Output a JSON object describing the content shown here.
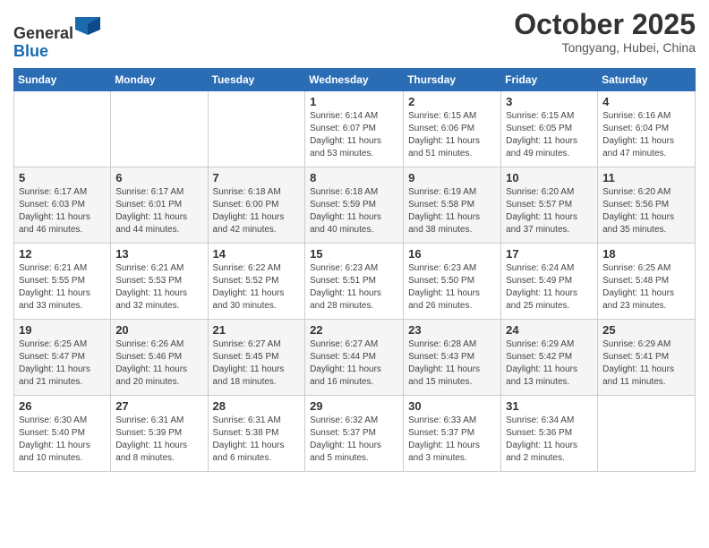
{
  "header": {
    "logo_general": "General",
    "logo_blue": "Blue",
    "month_title": "October 2025",
    "location": "Tongyang, Hubei, China"
  },
  "weekdays": [
    "Sunday",
    "Monday",
    "Tuesday",
    "Wednesday",
    "Thursday",
    "Friday",
    "Saturday"
  ],
  "weeks": [
    [
      {
        "day": "",
        "info": ""
      },
      {
        "day": "",
        "info": ""
      },
      {
        "day": "",
        "info": ""
      },
      {
        "day": "1",
        "info": "Sunrise: 6:14 AM\nSunset: 6:07 PM\nDaylight: 11 hours\nand 53 minutes."
      },
      {
        "day": "2",
        "info": "Sunrise: 6:15 AM\nSunset: 6:06 PM\nDaylight: 11 hours\nand 51 minutes."
      },
      {
        "day": "3",
        "info": "Sunrise: 6:15 AM\nSunset: 6:05 PM\nDaylight: 11 hours\nand 49 minutes."
      },
      {
        "day": "4",
        "info": "Sunrise: 6:16 AM\nSunset: 6:04 PM\nDaylight: 11 hours\nand 47 minutes."
      }
    ],
    [
      {
        "day": "5",
        "info": "Sunrise: 6:17 AM\nSunset: 6:03 PM\nDaylight: 11 hours\nand 46 minutes."
      },
      {
        "day": "6",
        "info": "Sunrise: 6:17 AM\nSunset: 6:01 PM\nDaylight: 11 hours\nand 44 minutes."
      },
      {
        "day": "7",
        "info": "Sunrise: 6:18 AM\nSunset: 6:00 PM\nDaylight: 11 hours\nand 42 minutes."
      },
      {
        "day": "8",
        "info": "Sunrise: 6:18 AM\nSunset: 5:59 PM\nDaylight: 11 hours\nand 40 minutes."
      },
      {
        "day": "9",
        "info": "Sunrise: 6:19 AM\nSunset: 5:58 PM\nDaylight: 11 hours\nand 38 minutes."
      },
      {
        "day": "10",
        "info": "Sunrise: 6:20 AM\nSunset: 5:57 PM\nDaylight: 11 hours\nand 37 minutes."
      },
      {
        "day": "11",
        "info": "Sunrise: 6:20 AM\nSunset: 5:56 PM\nDaylight: 11 hours\nand 35 minutes."
      }
    ],
    [
      {
        "day": "12",
        "info": "Sunrise: 6:21 AM\nSunset: 5:55 PM\nDaylight: 11 hours\nand 33 minutes."
      },
      {
        "day": "13",
        "info": "Sunrise: 6:21 AM\nSunset: 5:53 PM\nDaylight: 11 hours\nand 32 minutes."
      },
      {
        "day": "14",
        "info": "Sunrise: 6:22 AM\nSunset: 5:52 PM\nDaylight: 11 hours\nand 30 minutes."
      },
      {
        "day": "15",
        "info": "Sunrise: 6:23 AM\nSunset: 5:51 PM\nDaylight: 11 hours\nand 28 minutes."
      },
      {
        "day": "16",
        "info": "Sunrise: 6:23 AM\nSunset: 5:50 PM\nDaylight: 11 hours\nand 26 minutes."
      },
      {
        "day": "17",
        "info": "Sunrise: 6:24 AM\nSunset: 5:49 PM\nDaylight: 11 hours\nand 25 minutes."
      },
      {
        "day": "18",
        "info": "Sunrise: 6:25 AM\nSunset: 5:48 PM\nDaylight: 11 hours\nand 23 minutes."
      }
    ],
    [
      {
        "day": "19",
        "info": "Sunrise: 6:25 AM\nSunset: 5:47 PM\nDaylight: 11 hours\nand 21 minutes."
      },
      {
        "day": "20",
        "info": "Sunrise: 6:26 AM\nSunset: 5:46 PM\nDaylight: 11 hours\nand 20 minutes."
      },
      {
        "day": "21",
        "info": "Sunrise: 6:27 AM\nSunset: 5:45 PM\nDaylight: 11 hours\nand 18 minutes."
      },
      {
        "day": "22",
        "info": "Sunrise: 6:27 AM\nSunset: 5:44 PM\nDaylight: 11 hours\nand 16 minutes."
      },
      {
        "day": "23",
        "info": "Sunrise: 6:28 AM\nSunset: 5:43 PM\nDaylight: 11 hours\nand 15 minutes."
      },
      {
        "day": "24",
        "info": "Sunrise: 6:29 AM\nSunset: 5:42 PM\nDaylight: 11 hours\nand 13 minutes."
      },
      {
        "day": "25",
        "info": "Sunrise: 6:29 AM\nSunset: 5:41 PM\nDaylight: 11 hours\nand 11 minutes."
      }
    ],
    [
      {
        "day": "26",
        "info": "Sunrise: 6:30 AM\nSunset: 5:40 PM\nDaylight: 11 hours\nand 10 minutes."
      },
      {
        "day": "27",
        "info": "Sunrise: 6:31 AM\nSunset: 5:39 PM\nDaylight: 11 hours\nand 8 minutes."
      },
      {
        "day": "28",
        "info": "Sunrise: 6:31 AM\nSunset: 5:38 PM\nDaylight: 11 hours\nand 6 minutes."
      },
      {
        "day": "29",
        "info": "Sunrise: 6:32 AM\nSunset: 5:37 PM\nDaylight: 11 hours\nand 5 minutes."
      },
      {
        "day": "30",
        "info": "Sunrise: 6:33 AM\nSunset: 5:37 PM\nDaylight: 11 hours\nand 3 minutes."
      },
      {
        "day": "31",
        "info": "Sunrise: 6:34 AM\nSunset: 5:36 PM\nDaylight: 11 hours\nand 2 minutes."
      },
      {
        "day": "",
        "info": ""
      }
    ]
  ]
}
